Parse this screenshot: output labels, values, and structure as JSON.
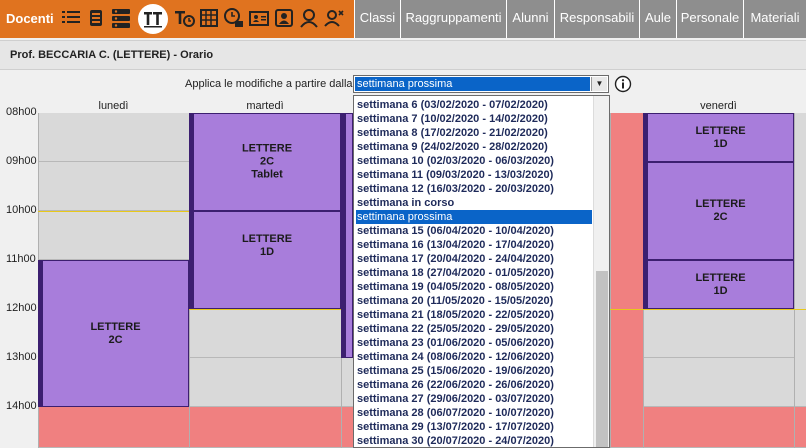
{
  "toolbar": {
    "brand": "Docenti",
    "icons": [
      "list-icon",
      "card-icon",
      "multi-card-icon",
      "timetable-icon",
      "teacher-timetable-icon",
      "grid-icon",
      "clock-calendar-icon",
      "id-card-icon",
      "person-card-icon",
      "user-icon",
      "user-swap-icon"
    ],
    "tabs": [
      "Classi",
      "Raggruppamenti",
      "Alunni",
      "Responsabili",
      "Aule",
      "Personale",
      "Materiali"
    ],
    "color": "#e0731f"
  },
  "header": {
    "title": "Prof. BECCARIA C. (LETTERE)  - Orario"
  },
  "apply": {
    "label": "Applica le modifiche a partire dalla",
    "selected": "settimana prossima"
  },
  "days": [
    "lunedì",
    "martedì",
    "",
    "",
    "venerdì"
  ],
  "hours": [
    "08h00",
    "09h00",
    "10h00",
    "11h00",
    "12h00",
    "13h00",
    "14h00"
  ],
  "lessons": [
    {
      "subject": "LETTERE",
      "class": "2C",
      "note": ""
    },
    {
      "subject": "LETTERE",
      "class": "2C",
      "note": "Tablet"
    },
    {
      "subject": "LETTERE",
      "class": "1D",
      "note": ""
    },
    {
      "subject": "LETTERE",
      "class": "1D",
      "note": ""
    },
    {
      "subject": "LETTERE",
      "class": "2C",
      "note": ""
    },
    {
      "subject": "LETTERE",
      "class": "1D",
      "note": ""
    }
  ],
  "dropdown": {
    "options": [
      "settimana 6 (03/02/2020 - 07/02/2020)",
      "settimana 7 (10/02/2020 - 14/02/2020)",
      "settimana 8 (17/02/2020 - 21/02/2020)",
      "settimana 9 (24/02/2020 - 28/02/2020)",
      "settimana 10 (02/03/2020 - 06/03/2020)",
      "settimana 11 (09/03/2020 - 13/03/2020)",
      "settimana 12 (16/03/2020 - 20/03/2020)",
      "settimana in corso",
      "settimana prossima",
      "settimana 15 (06/04/2020 - 10/04/2020)",
      "settimana 16 (13/04/2020 - 17/04/2020)",
      "settimana 17 (20/04/2020 - 24/04/2020)",
      "settimana 18 (27/04/2020 - 01/05/2020)",
      "settimana 19 (04/05/2020 - 08/05/2020)",
      "settimana 20 (11/05/2020 - 15/05/2020)",
      "settimana 21 (18/05/2020 - 22/05/2020)",
      "settimana 22 (25/05/2020 - 29/05/2020)",
      "settimana 23 (01/06/2020 - 05/06/2020)",
      "settimana 24 (08/06/2020 - 12/06/2020)",
      "settimana 25 (15/06/2020 - 19/06/2020)",
      "settimana 26 (22/06/2020 - 26/06/2020)",
      "settimana 27 (29/06/2020 - 03/07/2020)",
      "settimana 28 (06/07/2020 - 10/07/2020)",
      "settimana 29 (13/07/2020 - 17/07/2020)",
      "settimana 30 (20/07/2020 - 24/07/2020)"
    ]
  },
  "colors": {
    "lesson": "#a87ddb",
    "lesson_border": "#3c1f70",
    "free": "#d9d9d9",
    "unavailable": "#f08080",
    "selection": "#0a64c8"
  }
}
